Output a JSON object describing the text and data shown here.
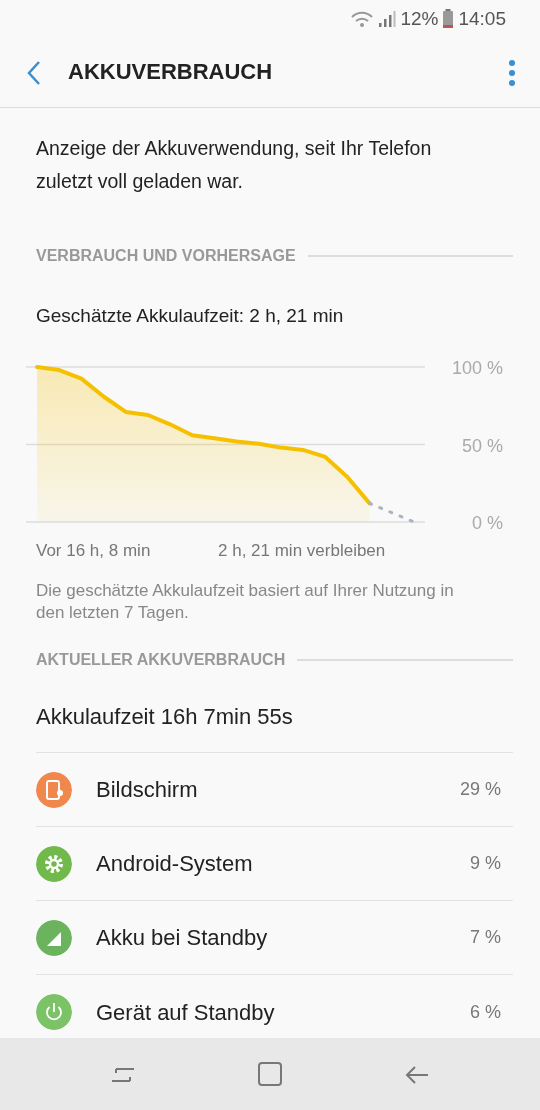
{
  "status_bar": {
    "battery": "12%",
    "time": "14:05"
  },
  "header": {
    "title": "AKKUVERBRAUCH"
  },
  "intro": "Anzeige der Akkuverwendung, seit Ihr Telefon zuletzt voll geladen war.",
  "forecast_section": {
    "heading": "VERBRAUCH UND VORHERSAGE",
    "estimate": "Geschätzte Akkulaufzeit: 2 h, 21 min",
    "chart_data": {
      "type": "area",
      "categories": [
        null,
        null,
        null,
        null,
        null,
        null,
        null,
        null,
        null,
        null,
        null,
        null,
        null,
        null,
        null,
        null,
        null,
        null
      ],
      "series": [
        {
          "color": "#f5c000",
          "line_style": "solid",
          "values": [
            100,
            98,
            92.5,
            81,
            71,
            69,
            63,
            56,
            54,
            52,
            50.5,
            48,
            46.5,
            42,
            29,
            12,
            null,
            null
          ]
        },
        {
          "type": "line",
          "color": "#a9b4c2",
          "line_style": "dotted",
          "values": [
            null,
            null,
            null,
            null,
            null,
            null,
            null,
            null,
            null,
            null,
            null,
            null,
            null,
            null,
            null,
            12,
            6,
            0
          ]
        }
      ],
      "ylim": [
        0,
        100
      ],
      "yticks": [
        {
          "value": 100,
          "label": "100 %"
        },
        {
          "value": 50,
          "label": "50 %"
        },
        {
          "value": 0,
          "label": "0 %"
        }
      ]
    },
    "start_label": "Vor 16 h, 8 min",
    "end_label": "2 h, 21 min verbleiben",
    "note": "Die geschätzte Akkulaufzeit basiert auf Ihrer Nutzung in den letzten 7 Tagen."
  },
  "usage_section": {
    "heading": "AKTUELLER AKKUVERBRAUCH",
    "runtime": "Akkulaufzeit 16h 7min 55s",
    "items": [
      {
        "kind": "screen",
        "label": "Bildschirm",
        "percent": "29 %",
        "color": "#f0874c"
      },
      {
        "kind": "system",
        "label": "Android-System",
        "percent": "9 %",
        "color": "#72b94c"
      },
      {
        "kind": "cell",
        "label": "Akku bei Standby",
        "percent": "7 %",
        "color": "#6cb35e"
      },
      {
        "kind": "idle",
        "label": "Gerät auf Standby",
        "percent": "6 %",
        "color": "#7cc266"
      }
    ]
  }
}
